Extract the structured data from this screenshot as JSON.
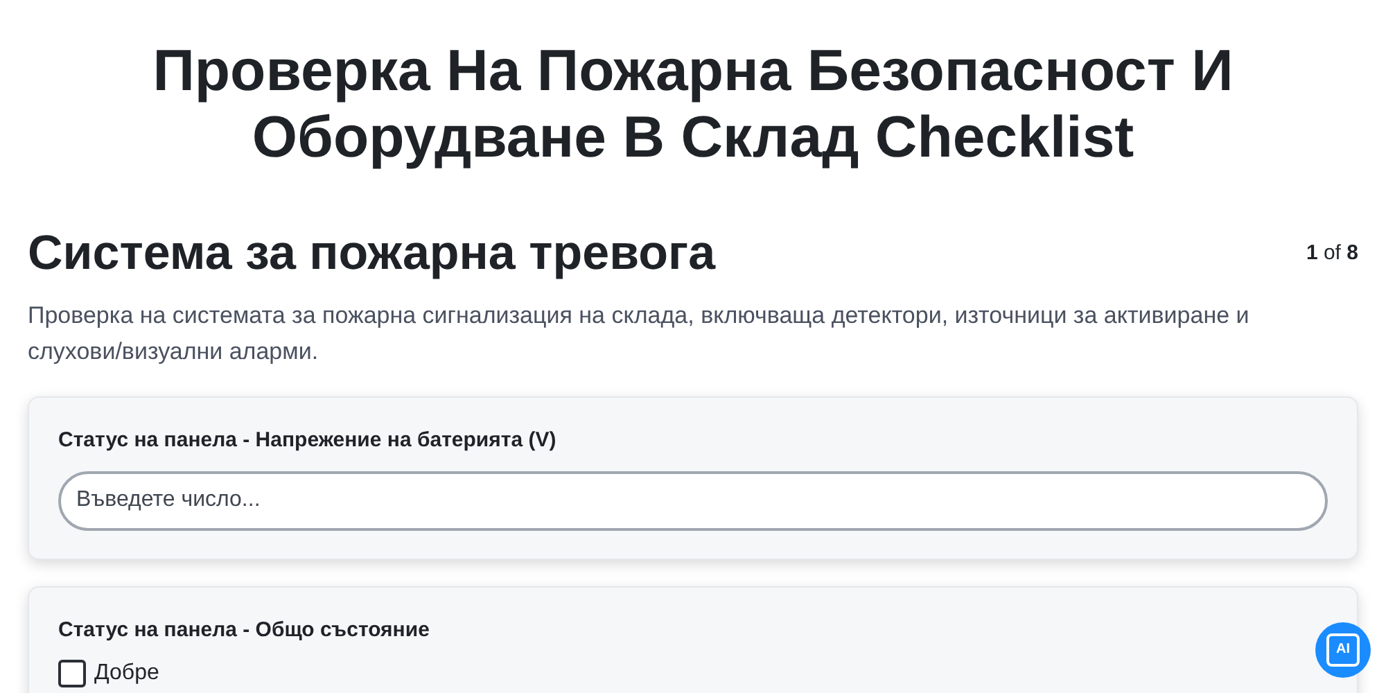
{
  "title": "Проверка На Пожарна Безопасност И Оборудване В Склад Checklist",
  "section": {
    "heading": "Система за пожарна тревога",
    "page_current": "1",
    "page_of": "of",
    "page_total": "8",
    "description": "Проверка на системата за пожарна сигнализация на склада, включваща детектори, източници за активиране и слухови/визуални аларми."
  },
  "questions": [
    {
      "kind": "number",
      "label": "Статус на панела - Напрежение на батерията (V)",
      "placeholder": "Въведете число..."
    },
    {
      "kind": "checklist",
      "label": "Статус на панела - Общо състояние",
      "options": [
        {
          "label": "Добре",
          "checked": false
        }
      ]
    }
  ],
  "ai_button": {
    "label": "AI"
  }
}
